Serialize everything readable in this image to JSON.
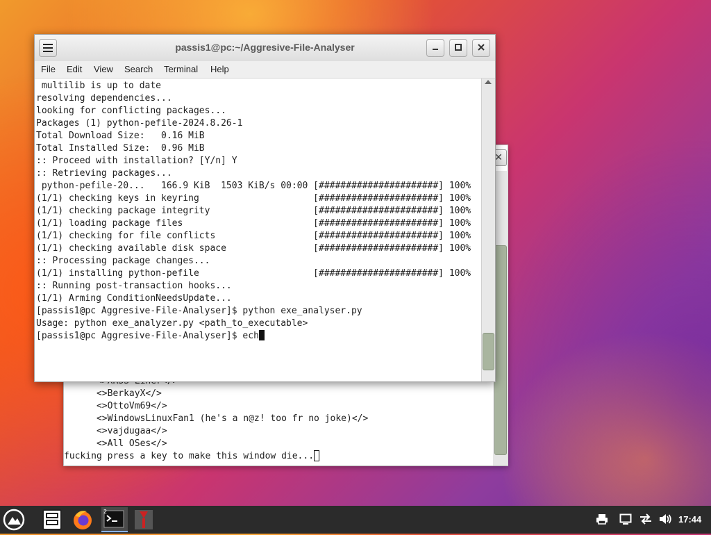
{
  "front_window": {
    "title": "passis1@pc:~/Aggresive-File-Analyser",
    "menu": [
      "File",
      "Edit",
      "View",
      "Search",
      "Terminal",
      "Help"
    ],
    "lines": [
      " multilib is up to date",
      "resolving dependencies...",
      "looking for conflicting packages...",
      "",
      "Packages (1) python-pefile-2024.8.26-1",
      "",
      "Total Download Size:   0.16 MiB",
      "Total Installed Size:  0.96 MiB",
      "",
      ":: Proceed with installation? [Y/n] Y",
      ":: Retrieving packages...",
      " python-pefile-20...   166.9 KiB  1503 KiB/s 00:00 [######################] 100%",
      "(1/1) checking keys in keyring                     [######################] 100%",
      "(1/1) checking package integrity                   [######################] 100%",
      "(1/1) loading package files                        [######################] 100%",
      "(1/1) checking for file conflicts                  [######################] 100%",
      "(1/1) checking available disk space                [######################] 100%",
      ":: Processing package changes...",
      "(1/1) installing python-pefile                     [######################] 100%",
      ":: Running post-transaction hooks...",
      "(1/1) Arming ConditionNeedsUpdate...",
      "[passis1@pc Aggresive-File-Analyser]$ python exe_analyser.py",
      "Usage: python exe_analyzer.py <path_to_executable>"
    ],
    "prompt_line": "[passis1@pc Aggresive-File-Analyser]$ ech"
  },
  "back_window": {
    "close_glyph": "✕",
    "lines": [
      "      <>XRSS Liner</>",
      "      <>BerkayX</>",
      "      <>OttoVm69</>",
      "      <>WindowsLinuxFan1 (he's a n@z! too fr no joke)</>",
      "      <>vajdugaa</>",
      "      <>All OSes</>"
    ],
    "prompt_line": "fucking press a key to make this window die..."
  },
  "taskbar": {
    "clock": "17:44",
    "apps": [
      "launcher-icon",
      "file-manager-icon",
      "firefox-icon",
      "terminal-icon",
      "app-icon"
    ],
    "terminal_badge": "2"
  },
  "colors": {
    "accent": "#2b2b2b",
    "scroll_thumb": "#a9b59f"
  }
}
